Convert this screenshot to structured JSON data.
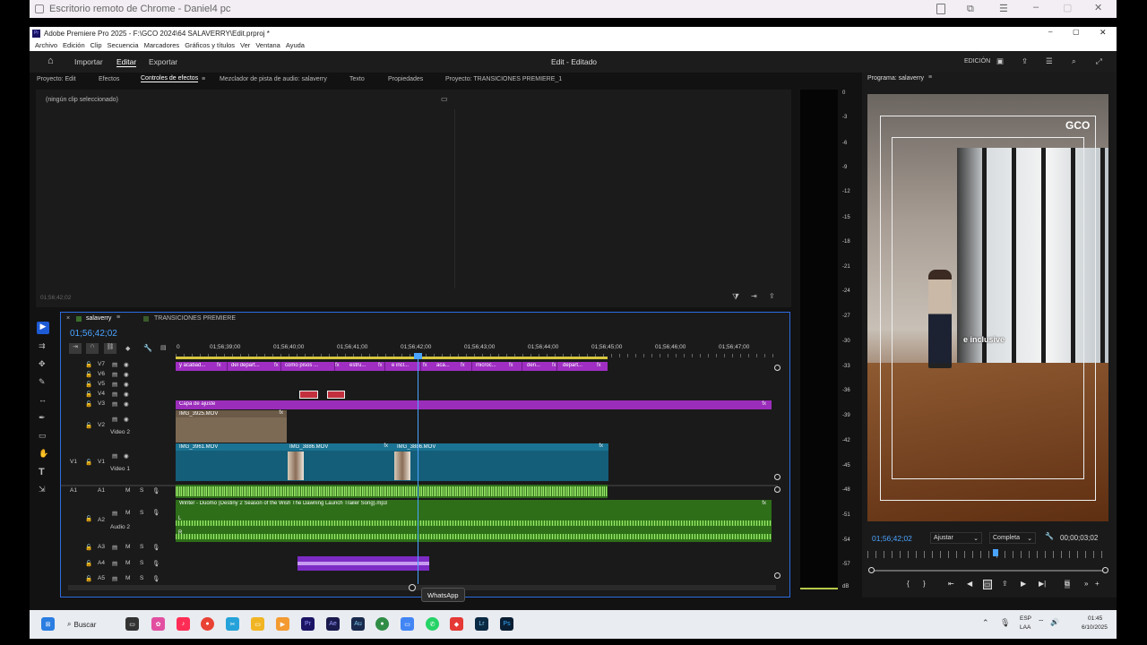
{
  "chrome": {
    "title": "Escritorio remoto de Chrome - Daniel4 pc"
  },
  "app": {
    "title": "Adobe Premiere Pro 2025 - F:\\GCO 2024\\64 SALAVERRY\\Edit.prproj *"
  },
  "menu": [
    "Archivo",
    "Edición",
    "Clip",
    "Secuencia",
    "Marcadores",
    "Gráficos y títulos",
    "Ver",
    "Ventana",
    "Ayuda"
  ],
  "workspace": {
    "home": "Importar",
    "edit": "Editar",
    "export": "Exportar",
    "center": "Edit - Editado",
    "right": "EDICIÓN"
  },
  "top_tabs": [
    "Proyecto: Edit",
    "Efectos",
    "Controles de efectos",
    "Mezclador de pista de audio: salaverry",
    "Texto",
    "Propiedades",
    "Proyecto: TRANSICIONES PREMIERE_1"
  ],
  "effects": {
    "no_clip": "(ningún clip seleccionado)",
    "timecode": "01;56;42;02"
  },
  "program": {
    "title": "Programa: salaverry",
    "timecode": "01;56;42;02",
    "fit": "Ajustar",
    "quality": "Completa",
    "duration": "00;00;03;02",
    "overlay_text": "e inclusive",
    "logo": "GCO"
  },
  "meter_labels": [
    "0",
    "-3",
    "-6",
    "-9",
    "-12",
    "-15",
    "-18",
    "-21",
    "-24",
    "-27",
    "-30",
    "-33",
    "-36",
    "-39",
    "-42",
    "-45",
    "-48",
    "-51",
    "-54",
    "-57",
    "dB"
  ],
  "timeline": {
    "tabs": [
      "salaverry",
      "TRANSICIONES PREMIERE"
    ],
    "timecode": "01;56;42;02",
    "ruler": [
      "0",
      "01;56;39;00",
      "01;56;40;00",
      "01;56;41;00",
      "01;56;42;00",
      "01;56;43;00",
      "01;56;44;00",
      "01;56;45;00",
      "01;56;46;00",
      "01;56;47;00"
    ],
    "tracks_video": [
      {
        "id": "V7"
      },
      {
        "id": "V6"
      },
      {
        "id": "V5"
      },
      {
        "id": "V4"
      },
      {
        "id": "V3"
      },
      {
        "id": "V2",
        "name": "Video 2"
      },
      {
        "id": "V1",
        "name": "Video 1"
      }
    ],
    "tracks_audio": [
      {
        "id": "A1"
      },
      {
        "id": "A2",
        "name": "Audio 2"
      },
      {
        "id": "A3"
      },
      {
        "id": "A4"
      },
      {
        "id": "A5"
      }
    ],
    "track_toggles": {
      "mute": "M",
      "solo": "S",
      "src_v1": "V1",
      "src_a1": "A1"
    },
    "v7_clips": [
      "y acabad...",
      "del depart...",
      "como pisos ...",
      "estru...",
      "e incl...",
      "aca...",
      "microc...",
      "den...",
      "depart..."
    ],
    "fx": "fx",
    "v3_clip": "Capa de ajuste",
    "v2_clip": "IMG_3925.MOV",
    "v1_clips": [
      "IMG_3961.MOV",
      "IMG_3886.MOV",
      "IMG_3886.MOV"
    ],
    "a2_clip": "Winter - Duomo (Destiny 2 Season of the Wish The Dawning Launch Trailer Song).mp3",
    "a2_channels": [
      "L",
      "R"
    ]
  },
  "tooltip": "WhatsApp",
  "taskbar": {
    "search": "Buscar",
    "lang1": "ESP",
    "lang2": "LAA",
    "time": "01:45",
    "date": "6/10/2025"
  }
}
